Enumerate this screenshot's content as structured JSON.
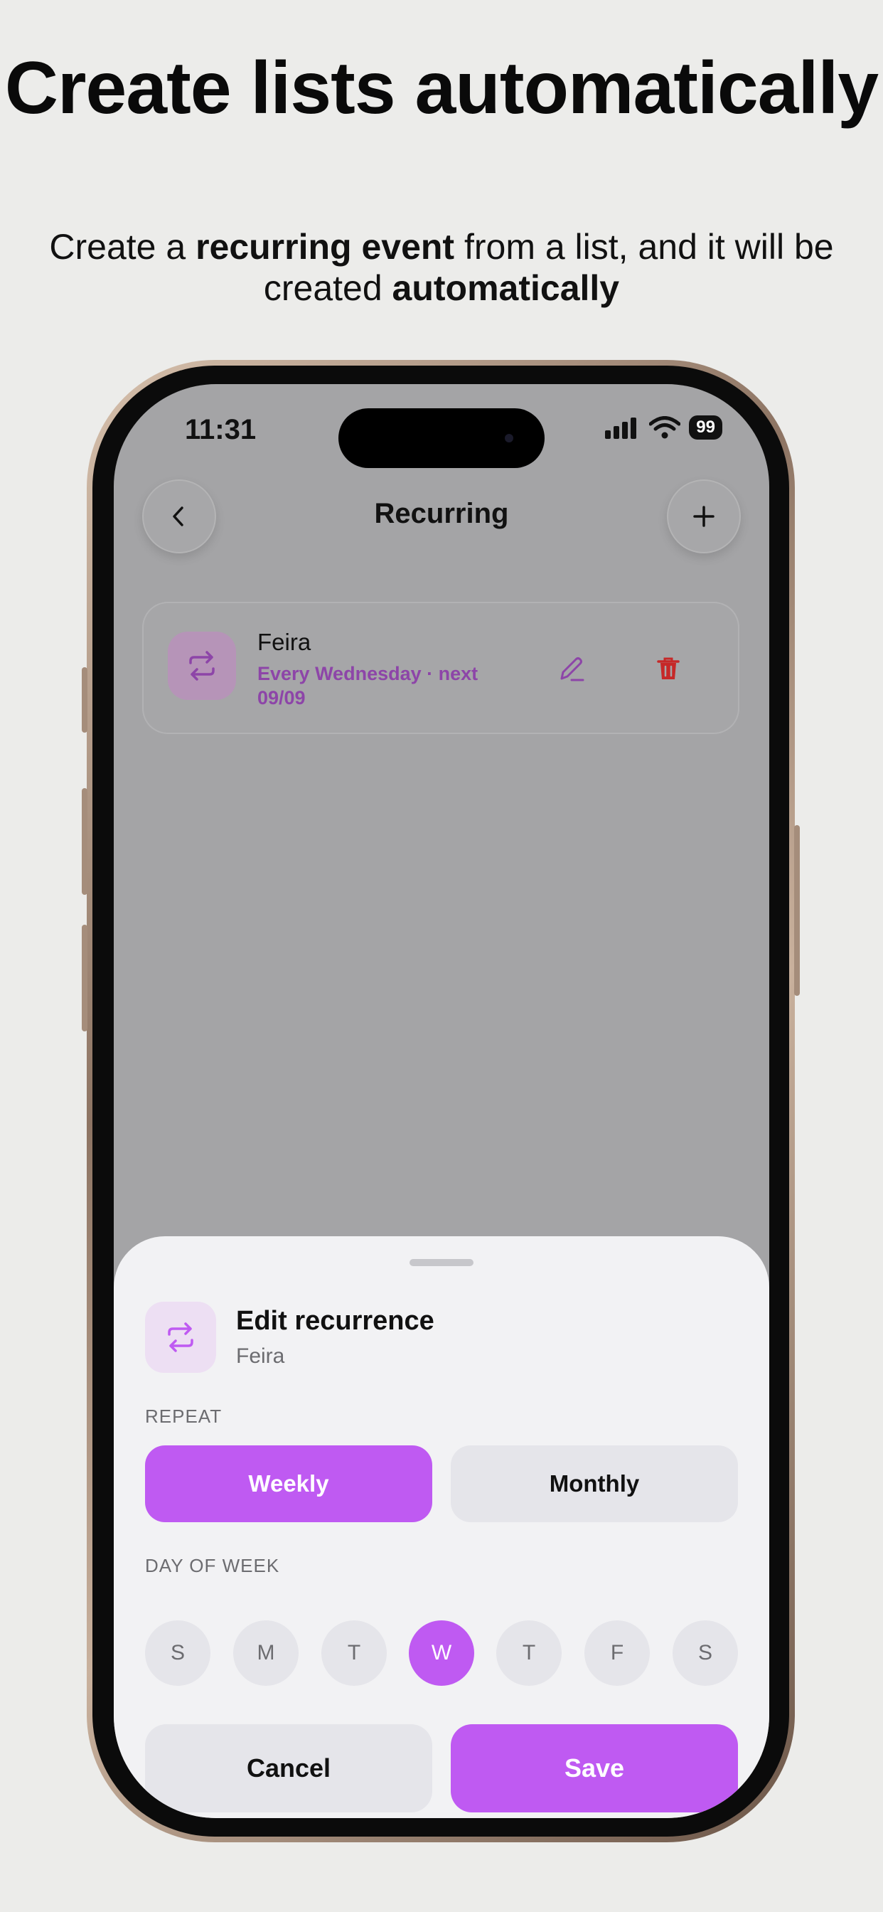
{
  "promo": {
    "headline": "Create lists automatically",
    "subline": {
      "part1": "Create a ",
      "bold1": "recurring event",
      "part2": " from a list, and it will be created ",
      "bold2": "automatically"
    }
  },
  "status_bar": {
    "time": "11:31",
    "battery": "99"
  },
  "nav": {
    "title": "Recurring",
    "back_icon": "chevron-left-icon",
    "add_icon": "plus-icon"
  },
  "recurring_list": [
    {
      "name": "Feira",
      "schedule": "Every Wednesday · next 09/09",
      "icon": "repeat-icon"
    }
  ],
  "sheet": {
    "title": "Edit recurrence",
    "subtitle": "Feira",
    "repeat_label": "REPEAT",
    "repeat_options": [
      {
        "label": "Weekly",
        "selected": true
      },
      {
        "label": "Monthly",
        "selected": false
      }
    ],
    "day_label": "DAY OF WEEK",
    "days": [
      {
        "label": "S",
        "selected": false
      },
      {
        "label": "M",
        "selected": false
      },
      {
        "label": "T",
        "selected": false
      },
      {
        "label": "W",
        "selected": true
      },
      {
        "label": "T",
        "selected": false
      },
      {
        "label": "F",
        "selected": false
      },
      {
        "label": "S",
        "selected": false
      }
    ],
    "cancel_label": "Cancel",
    "save_label": "Save"
  },
  "colors": {
    "accent": "#bf5af2",
    "schedule_text": "#8d45a8",
    "delete": "#c62828",
    "background": "#ececea"
  }
}
